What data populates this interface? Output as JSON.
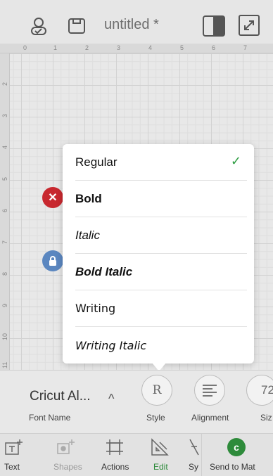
{
  "header": {
    "title": "untitled *",
    "icons": [
      "account-icon",
      "save-icon",
      "layers-panel-icon",
      "fullscreen-icon"
    ]
  },
  "ruler": {
    "top": [
      "0",
      "1",
      "2",
      "3",
      "4",
      "5",
      "6",
      "7"
    ],
    "left": [
      "2",
      "3",
      "4",
      "5",
      "6",
      "7",
      "8",
      "9",
      "10",
      "11"
    ]
  },
  "style_menu": {
    "options": [
      "Regular",
      "Bold",
      "Italic",
      "Bold Italic",
      "Writing",
      "Writing Italic"
    ],
    "selected": "Regular",
    "check": "✓"
  },
  "edit_panel": {
    "font_name": "Cricut Al...",
    "font_name_label": "Font Name",
    "style_value": "R",
    "style_label": "Style",
    "alignment_label": "Alignment",
    "size_value": "72",
    "size_label": "Siz"
  },
  "toolbar": {
    "items": [
      {
        "label": "Text"
      },
      {
        "label": "Shapes"
      },
      {
        "label": "Actions"
      },
      {
        "label": "Edit"
      },
      {
        "label": "Sy"
      }
    ],
    "send_label": "Send to Mat",
    "active_color": "#2e8b3b"
  }
}
